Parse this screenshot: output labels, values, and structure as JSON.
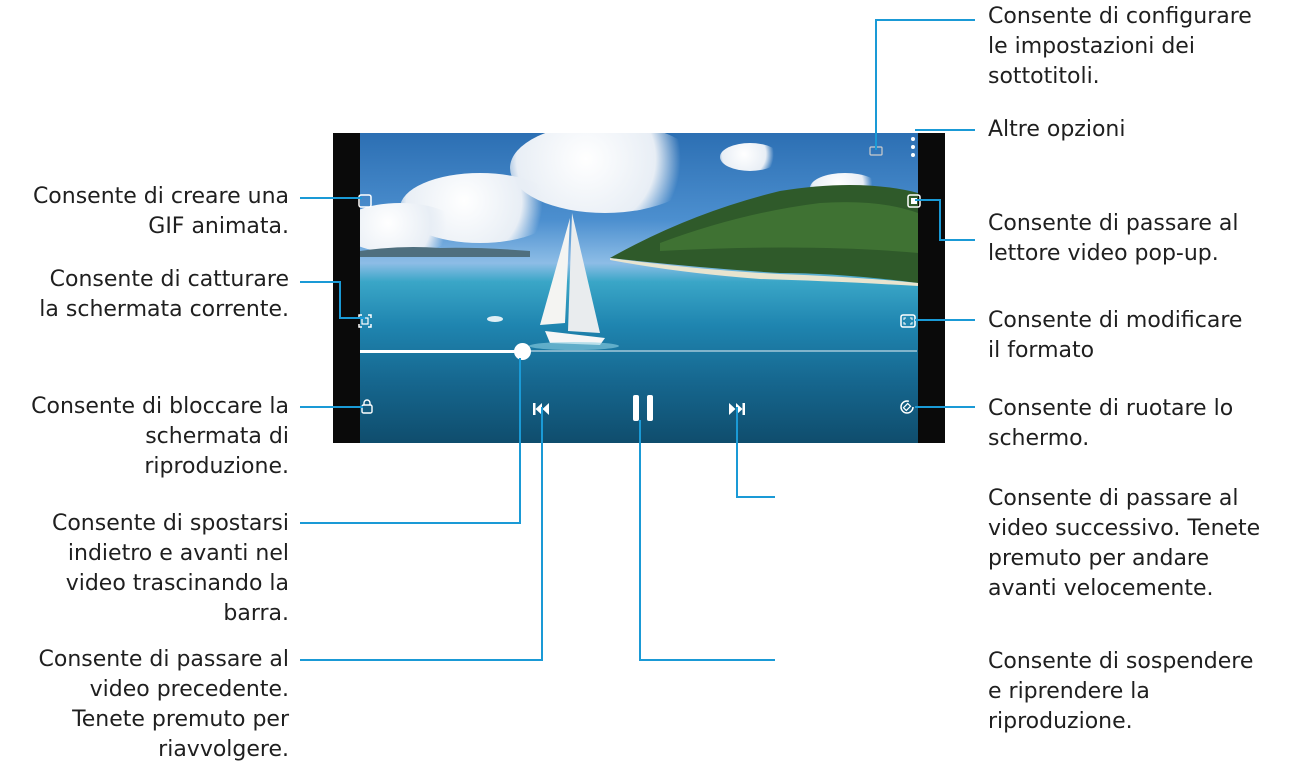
{
  "callouts": {
    "subtitles": "Consente di configurare\nle impostazioni dei\nsottotitoli.",
    "more_options": "Altre opzioni",
    "popup_player": "Consente di passare al\nlettore video pop-up.",
    "aspect_ratio": "Consente di modificare\nil formato",
    "rotate": "Consente di ruotare lo\nschermo.",
    "next_video": "Consente di passare al\nvideo successivo. Tenete\npremuto per andare\navanti velocemente.",
    "pause_resume": "Consente di sospendere\ne riprendere la\nriproduzione.",
    "gif": "Consente di creare una\nGIF animata.",
    "capture": "Consente di catturare\nla schermata corrente.",
    "lock": "Consente di bloccare la\nschermata di\nriproduzione.",
    "seek": "Consente di spostarsi\nindietro e avanti nel\nvideo trascinando la\nbarra.",
    "previous_video": "Consente di passare al\nvideo precedente.\nTenete premuto per\nriavvolgere."
  },
  "player": {
    "progress": 0.29,
    "icons": [
      "subtitles-icon",
      "more-options-icon",
      "popup-player-icon",
      "aspect-ratio-icon",
      "rotate-icon",
      "gif-icon",
      "capture-icon",
      "lock-icon",
      "previous-icon",
      "pause-icon",
      "next-icon"
    ]
  },
  "colors": {
    "leader": "#1a9ad6",
    "frame": "#0a0a0a"
  }
}
